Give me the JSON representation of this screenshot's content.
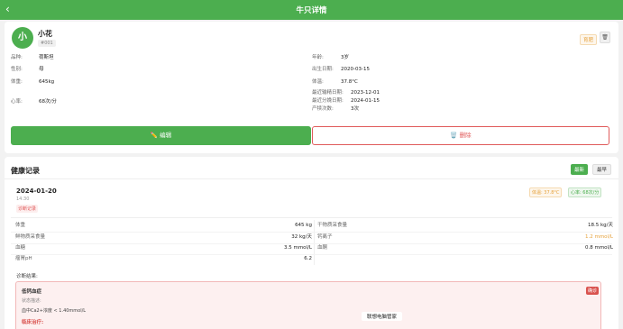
{
  "header": {
    "title": "牛只详情",
    "back_icon": "chevron-left-icon",
    "color": "#4cae4f"
  },
  "cow": {
    "avatar": "小",
    "name": "小花",
    "id": "#001",
    "status_tag": "育肥",
    "fields_left": [
      {
        "key": "品种:",
        "value": "荷斯坦"
      },
      {
        "key": "性别:",
        "value": "母"
      },
      {
        "key": "体重:",
        "value": "645kg"
      },
      {
        "key": "心率:",
        "value": "68次/分"
      }
    ],
    "fields_right": [
      {
        "key": "年龄:",
        "value": "3岁"
      },
      {
        "key": "出生日期:",
        "value": "2020-03-15"
      },
      {
        "key": "体温:",
        "value": "37.8°C"
      }
    ],
    "fields_right_extra": [
      {
        "key": "最近输精日期:",
        "value": "2023-12-01"
      },
      {
        "key": "最近分娩日期:",
        "value": "2024-01-15"
      },
      {
        "key": "产犊次数:",
        "value": "3次"
      }
    ]
  },
  "actions": {
    "edit_label": "✏️ 编辑",
    "delete_label": "🗑️ 删除"
  },
  "health": {
    "title": "健康记录",
    "tab_latest": "最新",
    "tab_oldest": "最早",
    "record": {
      "date": "2024-01-20",
      "time": "14:30",
      "type_badge": "诊断记录",
      "temp_badge": "体温: 37.8°C",
      "hr_badge": "心率: 68次/分",
      "metrics_left": [
        {
          "key": "体重",
          "value": "645 kg"
        },
        {
          "key": "鲜物质采食量",
          "value": "32 kg/天"
        },
        {
          "key": "血糖",
          "value": "3.5 mmol/L"
        },
        {
          "key": "瘤胃pH",
          "value": "6.2"
        }
      ],
      "metrics_right": [
        {
          "key": "干物质采食量",
          "value": "18.5 kg/天"
        },
        {
          "key": "钙离子",
          "value": "1.2 mmol/L",
          "warn": true
        },
        {
          "key": "血酮",
          "value": "0.8 mmol/L"
        }
      ],
      "diagnosis_label": "诊断结果:",
      "diagnosis": {
        "name": "低钙血症",
        "badge": "确诊",
        "sub": "状态描述:",
        "value": "血中Ca2+浓度 < 1.40mmol/L",
        "treatment_label": "临床治疗:"
      }
    }
  },
  "toast": "联想电脑管家"
}
